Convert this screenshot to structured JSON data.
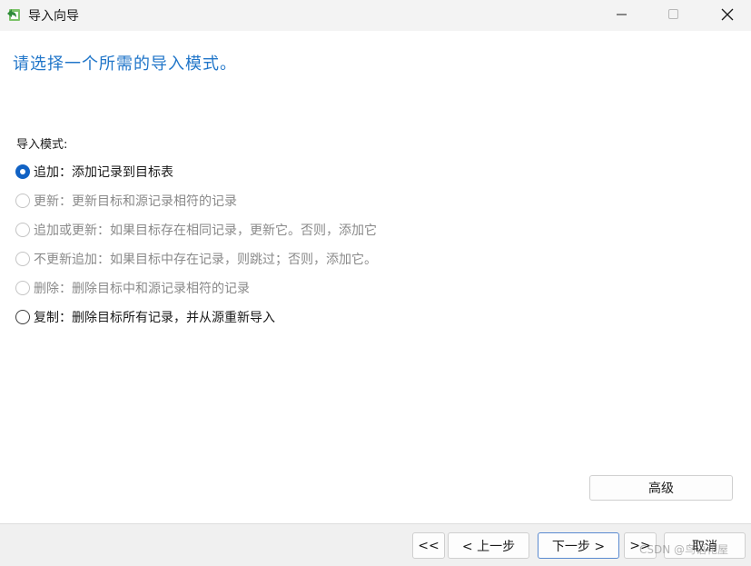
{
  "window": {
    "title": "导入向导",
    "icon": "import-wizard-icon",
    "controls": {
      "minimize": "minimize-icon",
      "maximize": "maximize-icon",
      "close": "close-icon"
    }
  },
  "page": {
    "heading": "请选择一个所需的导入模式。",
    "mode_label": "导入模式:",
    "options": [
      {
        "label": "追加：添加记录到目标表",
        "checked": true,
        "enabled": true
      },
      {
        "label": "更新：更新目标和源记录相符的记录",
        "checked": false,
        "enabled": false
      },
      {
        "label": "追加或更新：如果目标存在相同记录，更新它。否则，添加它",
        "checked": false,
        "enabled": false
      },
      {
        "label": "不更新追加：如果目标中存在记录，则跳过；否则，添加它。",
        "checked": false,
        "enabled": false
      },
      {
        "label": "删除：删除目标中和源记录相符的记录",
        "checked": false,
        "enabled": false
      },
      {
        "label": "复制：删除目标所有记录，并从源重新导入",
        "checked": false,
        "enabled": true
      }
    ],
    "advanced_label": "高级"
  },
  "footer": {
    "first_label": "<<",
    "prev_label": "< 上一步",
    "next_label": "下一步 >",
    "last_label": ">>",
    "cancel_label": "取消"
  },
  "watermark": "CSDN @鸟语花屋",
  "colors": {
    "heading": "#2176c9",
    "radio_checked": "#1162c4",
    "disabled_text": "#8a8a8a"
  }
}
